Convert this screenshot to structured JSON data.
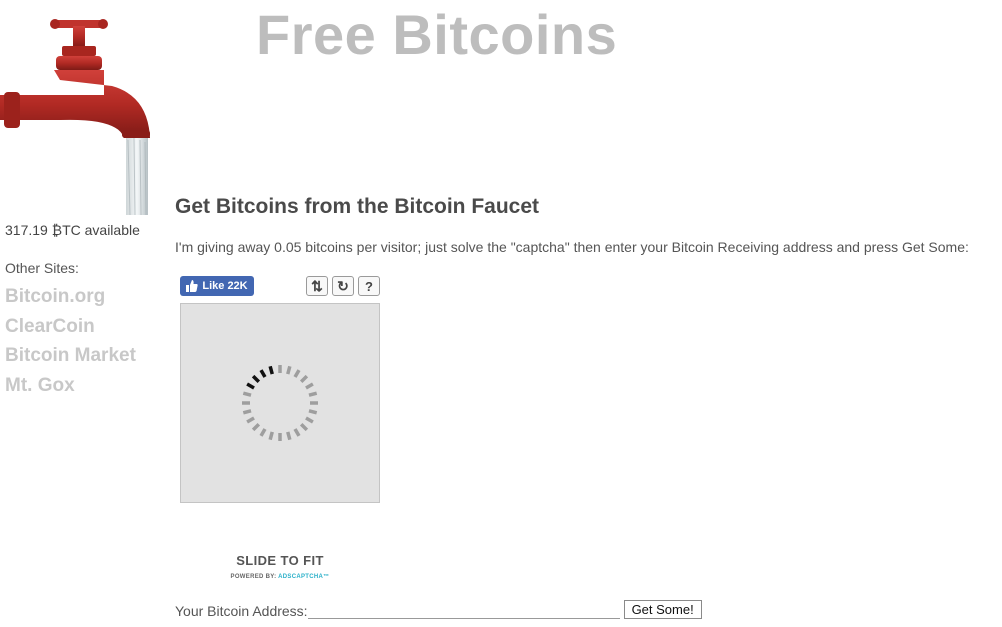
{
  "header": {
    "title": "Free Bitcoins"
  },
  "sidebar": {
    "available": "317.19 ₿TC available",
    "other_sites_label": "Other Sites:",
    "links": [
      "Bitcoin.org",
      "ClearCoin",
      "Bitcoin Market",
      "Mt. Gox"
    ]
  },
  "main": {
    "heading": "Get Bitcoins from the Bitcoin Faucet",
    "intro": "I'm giving away 0.05 bitcoins per visitor; just solve the \"captcha\" then enter your Bitcoin Receiving address and press Get Some:"
  },
  "social": {
    "like_label": "Like 22K"
  },
  "captcha": {
    "tools": [
      "swap-icon",
      "refresh-icon",
      "help-icon"
    ],
    "tool_glyphs": [
      "⇅",
      "↻",
      "?"
    ],
    "slide_label": "SLIDE TO FIT",
    "powered_prefix": "POWERED BY: ",
    "powered_brand": "ADSCAPTCHA™"
  },
  "form": {
    "address_label": "Your Bitcoin Address:",
    "address_value": "",
    "submit_label": "Get Some!"
  },
  "colors": {
    "title": "#bdbdbd",
    "faucet_red": "#b52a24",
    "facebook": "#4267b2",
    "link_gray": "#c8c8c8"
  }
}
